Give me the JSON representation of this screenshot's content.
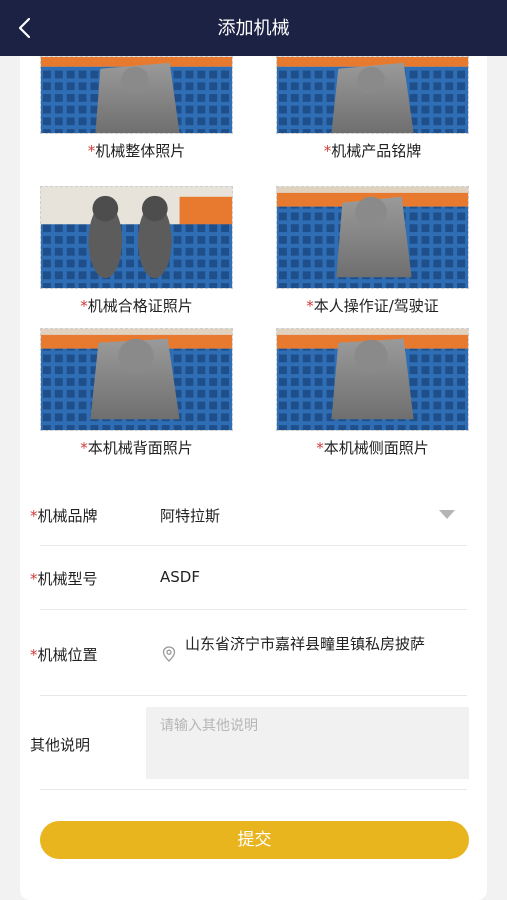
{
  "header": {
    "title": "添加机械",
    "back_icon": "chevron-left-icon"
  },
  "photos": [
    {
      "required": "*",
      "label": "机械整体照片"
    },
    {
      "required": "*",
      "label": "机械产品铭牌"
    },
    {
      "required": "*",
      "label": "机械合格证照片"
    },
    {
      "required": "*",
      "label": "本人操作证/驾驶证"
    },
    {
      "required": "*",
      "label": "本机械背面照片"
    },
    {
      "required": "*",
      "label": "本机械侧面照片"
    }
  ],
  "form": {
    "brand": {
      "required": "*",
      "label": "机械品牌",
      "value": "阿特拉斯",
      "icon": "dropdown-triangle-icon"
    },
    "model": {
      "required": "*",
      "label": "机械型号",
      "value": "ASDF"
    },
    "location": {
      "required": "*",
      "label": "机械位置",
      "value": "山东省济宁市嘉祥县疃里镇私房披萨",
      "icon": "location-pin-icon"
    },
    "notes": {
      "label": "其他说明",
      "placeholder": "请输入其他说明"
    }
  },
  "submit_label": "提交",
  "colors": {
    "header_bg": "#1b2244",
    "accent": "#e9b51f",
    "required": "#d23b3b"
  }
}
